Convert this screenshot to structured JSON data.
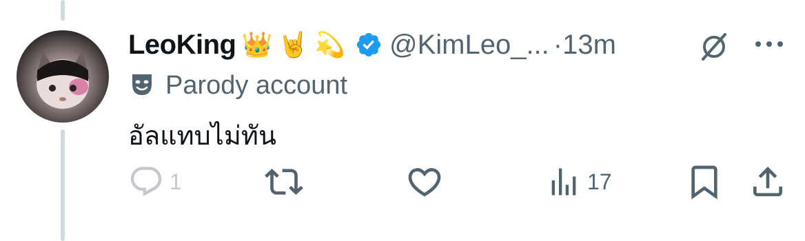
{
  "tweet": {
    "display_name": "LeoKing",
    "name_emojis": [
      "👑",
      "🤘",
      "💫"
    ],
    "handle": "@KimLeo_...",
    "time": "·13m",
    "parody_label": "Parody account",
    "text": "อัลแทบไม่ทัน"
  },
  "actions": {
    "reply_count": "1",
    "views_count": "17"
  },
  "icons": {
    "verified": "verified-badge-icon",
    "grok": "grok-icon",
    "more": "more-icon",
    "parody": "parody-mask-icon",
    "reply": "reply-icon",
    "retweet": "retweet-icon",
    "like": "heart-icon",
    "views": "views-icon",
    "bookmark": "bookmark-icon",
    "share": "share-icon"
  },
  "colors": {
    "verified": "#1d9bf0",
    "muted": "#536471",
    "text": "#0f1419",
    "thread_line": "#cfd9de"
  }
}
